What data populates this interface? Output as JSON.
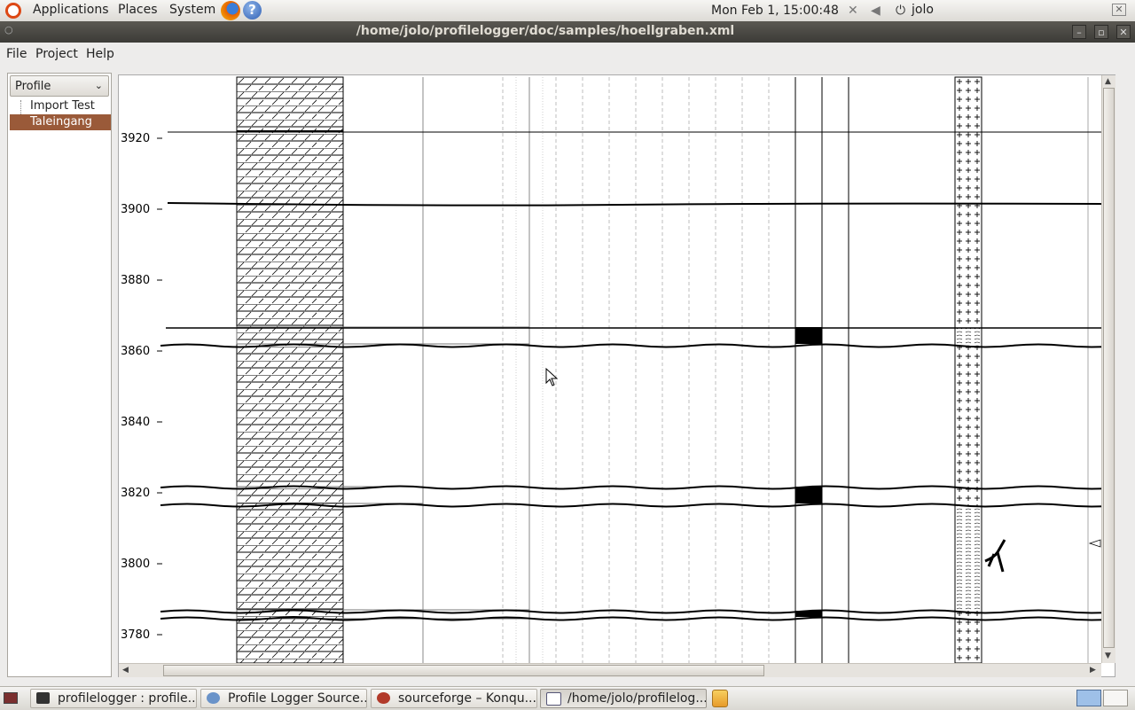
{
  "top_panel": {
    "applications": "Applications",
    "places": "Places",
    "system": "System",
    "help_glyph": "?",
    "clock": "Mon Feb  1, 15:00:48",
    "user": "jolo"
  },
  "window": {
    "title": "/home/jolo/profilelogger/doc/samples/hoellgraben.xml"
  },
  "menu": {
    "file": "File",
    "project": "Project",
    "help": "Help"
  },
  "sidebar": {
    "combo_value": "Profile",
    "items": [
      {
        "label": "Import Test",
        "selected": false
      },
      {
        "label": "Taleingang",
        "selected": true
      }
    ]
  },
  "canvas": {
    "depth_labels": [
      "3920",
      "3900",
      "3880",
      "3860",
      "3840",
      "3820",
      "3800",
      "3780"
    ]
  },
  "taskbar": {
    "tasks": [
      {
        "label": "profilelogger : profile..."
      },
      {
        "label": "Profile Logger Source..."
      },
      {
        "label": "sourceforge – Konqu..."
      },
      {
        "label": "/home/jolo/profilelog..."
      }
    ]
  },
  "colors": {
    "selection": "#9a5a39",
    "title_bar": "#3c3b37",
    "ubuntu_orange": "#dd4814"
  }
}
